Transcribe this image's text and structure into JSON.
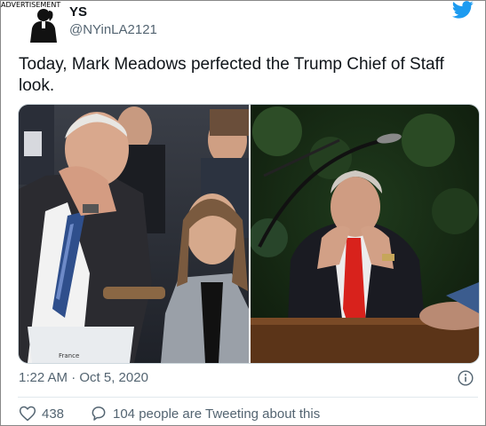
{
  "advertisement_label": "ADVERTISEMENT",
  "header": {
    "display_name": "YS",
    "handle": "@NYinLA2121",
    "avatar_icon": "user-silhouette-avatar",
    "brand_icon": "twitter-bird-icon",
    "brand_color": "#1d9bf0"
  },
  "tweet": {
    "text": "Today, Mark Meadows perfected the Trump Chief of Staff look.",
    "timestamp": "1:22 AM · Oct 5, 2020",
    "info_icon": "info-icon"
  },
  "media": {
    "left_placard": "France"
  },
  "actions": {
    "likes": "438",
    "like_icon": "heart-icon",
    "conversation": "104 people are Tweeting about this",
    "conversation_icon": "speech-bubble-icon"
  }
}
